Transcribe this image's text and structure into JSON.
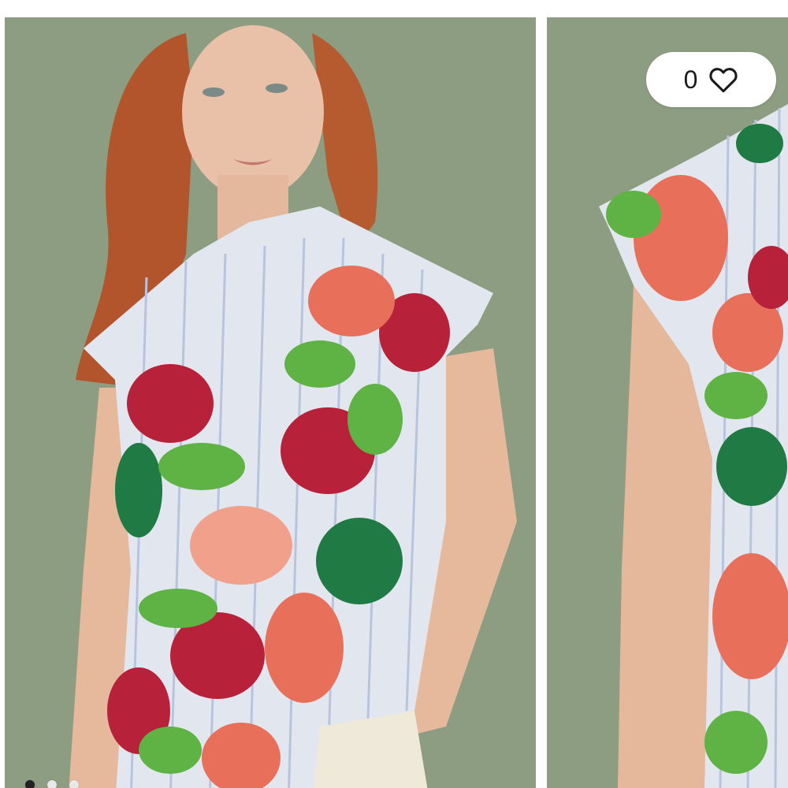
{
  "product_gallery": {
    "images": [
      {
        "subject": "model-front-view"
      },
      {
        "subject": "sleeve-detail-view"
      }
    ],
    "pagination": {
      "total": 3,
      "active_index": 0
    }
  },
  "wishlist": {
    "count": "0",
    "icon": "heart-outline-icon"
  },
  "colors": {
    "backdrop": "#8c9c80",
    "accent_red": "#c7283a",
    "accent_coral": "#e8705a",
    "accent_green": "#4e9b3a"
  }
}
